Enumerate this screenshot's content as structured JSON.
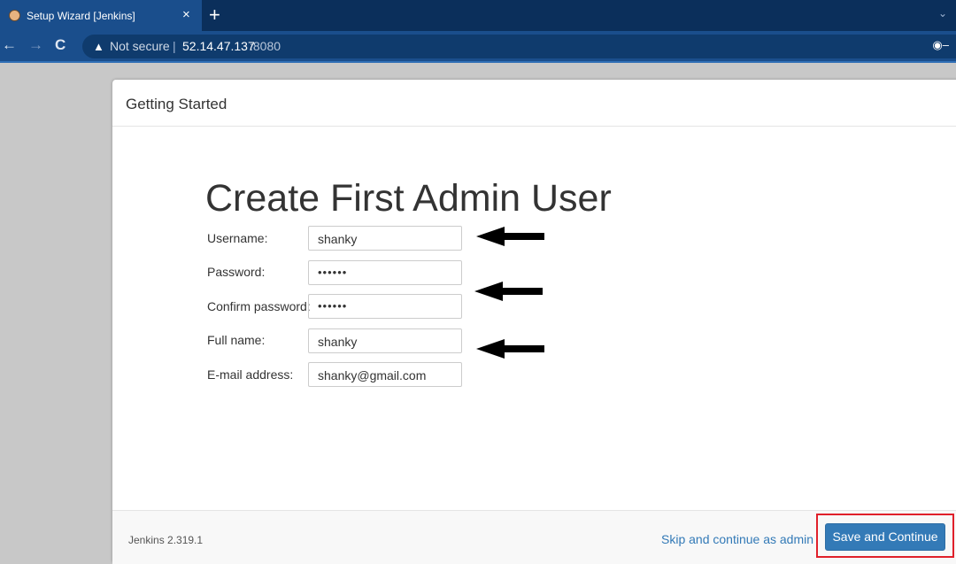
{
  "browser": {
    "tab_title": "Setup Wizard [Jenkins]",
    "tab_close": "×",
    "new_tab": "+",
    "back": "←",
    "forward": "→",
    "reload": "C",
    "security_label": "Not secure",
    "separator": "|",
    "host": "52.14.47.137",
    "port": ":8080"
  },
  "panel": {
    "header_title": "Getting Started",
    "heading": "Create First Admin User",
    "form": {
      "username_label": "Username:",
      "username_value": "shanky",
      "password_label": "Password:",
      "password_value": "••••••",
      "confirm_label": "Confirm password:",
      "confirm_value": "••••••",
      "fullname_label": "Full name:",
      "fullname_value": "shanky",
      "email_label": "E-mail address:",
      "email_value": "shanky@gmail.com"
    },
    "footer": {
      "version": "Jenkins 2.319.1",
      "skip_link": "Skip and continue as admin",
      "save_button": "Save and Continue"
    }
  },
  "colors": {
    "primary_button": "#337ab7",
    "highlight_box": "#e0202a",
    "tabbar": "#0b2f5b",
    "toolbar": "#1a4e8c"
  }
}
